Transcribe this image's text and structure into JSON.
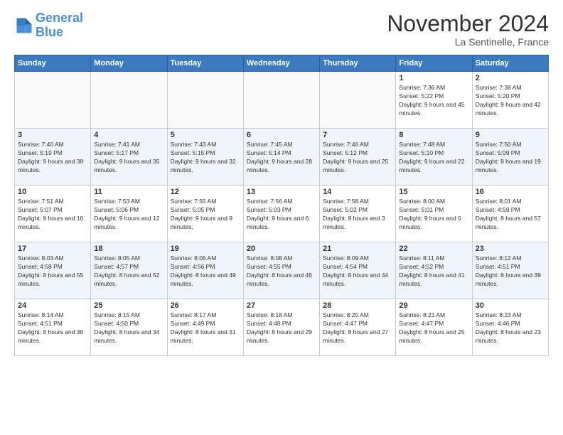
{
  "header": {
    "logo": {
      "line1": "General",
      "line2": "Blue"
    },
    "title": "November 2024",
    "location": "La Sentinelle, France"
  },
  "weekdays": [
    "Sunday",
    "Monday",
    "Tuesday",
    "Wednesday",
    "Thursday",
    "Friday",
    "Saturday"
  ],
  "weeks": [
    [
      {
        "day": "",
        "info": ""
      },
      {
        "day": "",
        "info": ""
      },
      {
        "day": "",
        "info": ""
      },
      {
        "day": "",
        "info": ""
      },
      {
        "day": "",
        "info": ""
      },
      {
        "day": "1",
        "info": "Sunrise: 7:36 AM\nSunset: 5:22 PM\nDaylight: 9 hours and 45 minutes."
      },
      {
        "day": "2",
        "info": "Sunrise: 7:38 AM\nSunset: 5:20 PM\nDaylight: 9 hours and 42 minutes."
      }
    ],
    [
      {
        "day": "3",
        "info": "Sunrise: 7:40 AM\nSunset: 5:19 PM\nDaylight: 9 hours and 38 minutes."
      },
      {
        "day": "4",
        "info": "Sunrise: 7:41 AM\nSunset: 5:17 PM\nDaylight: 9 hours and 35 minutes."
      },
      {
        "day": "5",
        "info": "Sunrise: 7:43 AM\nSunset: 5:15 PM\nDaylight: 9 hours and 32 minutes."
      },
      {
        "day": "6",
        "info": "Sunrise: 7:45 AM\nSunset: 5:14 PM\nDaylight: 9 hours and 28 minutes."
      },
      {
        "day": "7",
        "info": "Sunrise: 7:46 AM\nSunset: 5:12 PM\nDaylight: 9 hours and 25 minutes."
      },
      {
        "day": "8",
        "info": "Sunrise: 7:48 AM\nSunset: 5:10 PM\nDaylight: 9 hours and 22 minutes."
      },
      {
        "day": "9",
        "info": "Sunrise: 7:50 AM\nSunset: 5:09 PM\nDaylight: 9 hours and 19 minutes."
      }
    ],
    [
      {
        "day": "10",
        "info": "Sunrise: 7:51 AM\nSunset: 5:07 PM\nDaylight: 9 hours and 16 minutes."
      },
      {
        "day": "11",
        "info": "Sunrise: 7:53 AM\nSunset: 5:06 PM\nDaylight: 9 hours and 12 minutes."
      },
      {
        "day": "12",
        "info": "Sunrise: 7:55 AM\nSunset: 5:05 PM\nDaylight: 9 hours and 9 minutes."
      },
      {
        "day": "13",
        "info": "Sunrise: 7:56 AM\nSunset: 5:03 PM\nDaylight: 9 hours and 6 minutes."
      },
      {
        "day": "14",
        "info": "Sunrise: 7:58 AM\nSunset: 5:02 PM\nDaylight: 9 hours and 3 minutes."
      },
      {
        "day": "15",
        "info": "Sunrise: 8:00 AM\nSunset: 5:01 PM\nDaylight: 9 hours and 0 minutes."
      },
      {
        "day": "16",
        "info": "Sunrise: 8:01 AM\nSunset: 4:59 PM\nDaylight: 8 hours and 57 minutes."
      }
    ],
    [
      {
        "day": "17",
        "info": "Sunrise: 8:03 AM\nSunset: 4:58 PM\nDaylight: 8 hours and 55 minutes."
      },
      {
        "day": "18",
        "info": "Sunrise: 8:05 AM\nSunset: 4:57 PM\nDaylight: 8 hours and 52 minutes."
      },
      {
        "day": "19",
        "info": "Sunrise: 8:06 AM\nSunset: 4:56 PM\nDaylight: 8 hours and 49 minutes."
      },
      {
        "day": "20",
        "info": "Sunrise: 8:08 AM\nSunset: 4:55 PM\nDaylight: 8 hours and 46 minutes."
      },
      {
        "day": "21",
        "info": "Sunrise: 8:09 AM\nSunset: 4:54 PM\nDaylight: 8 hours and 44 minutes."
      },
      {
        "day": "22",
        "info": "Sunrise: 8:11 AM\nSunset: 4:52 PM\nDaylight: 8 hours and 41 minutes."
      },
      {
        "day": "23",
        "info": "Sunrise: 8:12 AM\nSunset: 4:51 PM\nDaylight: 8 hours and 39 minutes."
      }
    ],
    [
      {
        "day": "24",
        "info": "Sunrise: 8:14 AM\nSunset: 4:51 PM\nDaylight: 8 hours and 36 minutes."
      },
      {
        "day": "25",
        "info": "Sunrise: 8:15 AM\nSunset: 4:50 PM\nDaylight: 8 hours and 34 minutes."
      },
      {
        "day": "26",
        "info": "Sunrise: 8:17 AM\nSunset: 4:49 PM\nDaylight: 8 hours and 31 minutes."
      },
      {
        "day": "27",
        "info": "Sunrise: 8:18 AM\nSunset: 4:48 PM\nDaylight: 8 hours and 29 minutes."
      },
      {
        "day": "28",
        "info": "Sunrise: 8:20 AM\nSunset: 4:47 PM\nDaylight: 8 hours and 27 minutes."
      },
      {
        "day": "29",
        "info": "Sunrise: 8:21 AM\nSunset: 4:47 PM\nDaylight: 8 hours and 25 minutes."
      },
      {
        "day": "30",
        "info": "Sunrise: 8:23 AM\nSunset: 4:46 PM\nDaylight: 8 hours and 23 minutes."
      }
    ]
  ]
}
